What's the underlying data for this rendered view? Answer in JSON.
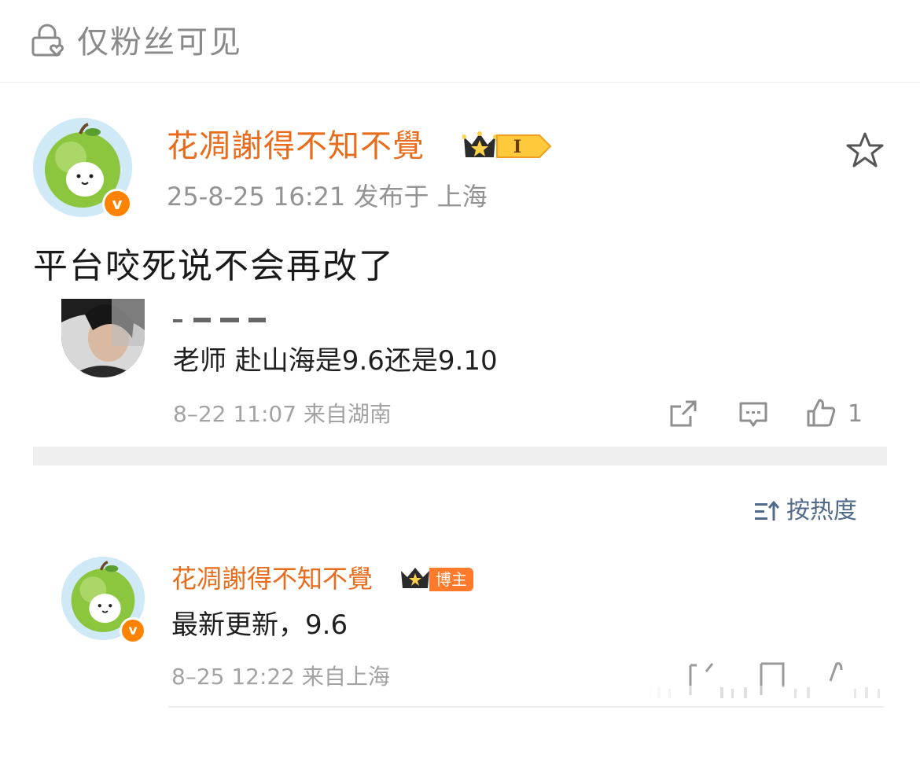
{
  "visibility": {
    "label": "仅粉丝可见",
    "icon": "lock-heart-icon"
  },
  "post": {
    "author": "花凋謝得不知不覺",
    "level_badge": "I",
    "verified_mark": "v",
    "meta": "25-8-25 16:21  发布于 上海",
    "text": "平台咬死说不会再改了",
    "favorite_icon": "star-icon"
  },
  "screenshot": {
    "comment": {
      "text": "老师 赴山海是9.6还是9.10",
      "meta": "8–22 11:07  来自湖南",
      "like_count": "1"
    },
    "sort": {
      "label": "按热度",
      "icon": "sort-icon"
    },
    "reply": {
      "author": "花凋謝得不知不覺",
      "tag": "博主",
      "verified_mark": "v",
      "text": "最新更新，9.6",
      "meta": "8–25 12:22  来自上海"
    }
  },
  "colors": {
    "accent": "#e86c1b",
    "verified": "#ff8200",
    "muted": "#939393",
    "link": "#506a8a"
  }
}
